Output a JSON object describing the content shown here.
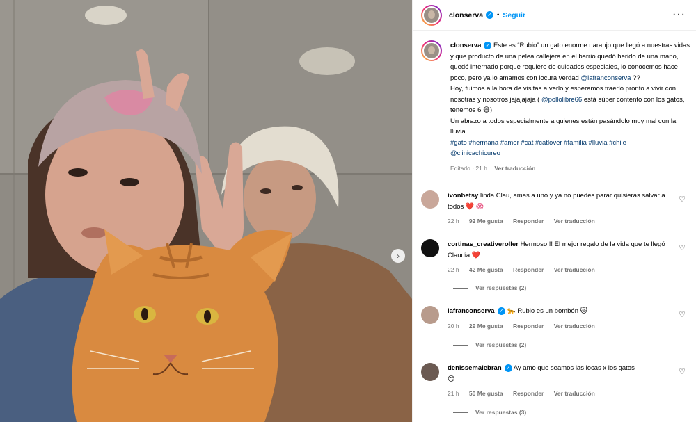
{
  "header": {
    "username": "clonserva",
    "follow_label": "Seguir",
    "more_icon": "more-options-icon"
  },
  "caption": {
    "username": "clonserva",
    "text1": "Este es “Rubio” un gato enorme naranjo que llegó a nuestras vidas y que producto de una pelea callejera en el barrio quedó herido de una mano, quedó internado porque requiere de cuidados especiales, lo conocemos hace poco, pero ya lo amamos con locura verdad ",
    "mention1": "@lafranconserva",
    "text2": " ??",
    "text3": "Hoy, fuimos a la hora de visitas a verlo y esperamos traerlo pronto a vivir con nosotras y nosotros jajajajaja ( ",
    "mention2": "@pollolibre66",
    "text4": " está súper contento con los gatos, tenemos 6 😅)",
    "text5": "Un abrazo a todos especialmente a quienes están pasándolo muy mal con la lluvia.",
    "hashtags": "#gato #hermana #amor #cat #catlover #familia #lluvia #chile",
    "mention3": "@clinicachicureo",
    "edited": "Editado · 21 h",
    "translate": "Ver traducción"
  },
  "comments": [
    {
      "username": "ivonbetsy",
      "verified": false,
      "text": "linda Clau, amas a uno y ya no puedes parar quisieras salvar a todos",
      "emoji": "❤️ 😱",
      "time": "22 h",
      "likes": "92 Me gusta",
      "reply": "Responder",
      "translate": "Ver traducción",
      "avatar_color": "#c9a79a"
    },
    {
      "username": "cortinas_creativeroller",
      "verified": false,
      "text": "Hermoso !! El mejor regalo de la vida que te llegó Claudia",
      "emoji": "❤️",
      "time": "22 h",
      "likes": "42 Me gusta",
      "reply": "Responder",
      "translate": "Ver traducción",
      "replies": "Ver respuestas (2)",
      "avatar_color": "#111111"
    },
    {
      "username": "lafranconserva",
      "verified": true,
      "text": "Rubio es un bombón",
      "emoji_before": "🐆",
      "emoji": "😻",
      "time": "20 h",
      "likes": "29 Me gusta",
      "reply": "Responder",
      "translate": "Ver traducción",
      "replies": "Ver respuestas (2)",
      "avatar_color": "#b89b8c"
    },
    {
      "username": "denissemalebran",
      "verified": true,
      "text": "Ay amo que seamos las locas x los gatos",
      "emoji": "😍",
      "time": "21 h",
      "likes": "50 Me gusta",
      "reply": "Responder",
      "translate": "Ver traducción",
      "replies": "Ver respuestas (3)",
      "avatar_color": "#6b5a52"
    }
  ],
  "colors": {
    "accent": "#0095f6",
    "link": "#00376b",
    "muted": "#737373"
  }
}
